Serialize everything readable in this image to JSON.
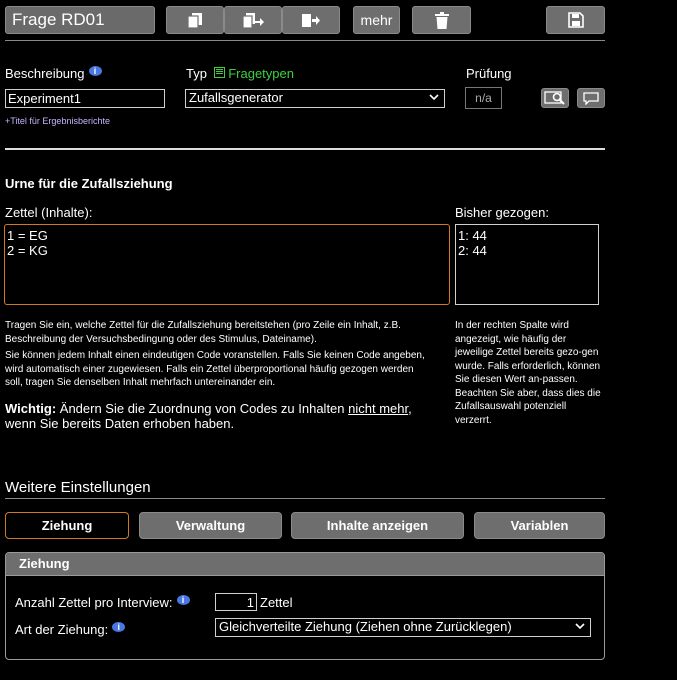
{
  "toolbar": {
    "question_id": "Frage RD01",
    "more_label": "mehr"
  },
  "header_fields": {
    "description_label": "Beschreibung",
    "description_value": "Experiment1",
    "type_label": "Typ",
    "question_types_link": "Fragetypen",
    "type_value": "Zufallsgenerator",
    "check_label": "Prüfung",
    "check_value": "n/a",
    "report_title_link": "+Titel für Ergebnisberichte"
  },
  "urn": {
    "heading": "Urne für die Zufallsziehung",
    "slips_label": "Zettel (Inhalte):",
    "slips_value": "1 = EG\n2 = KG",
    "drawn_label": "Bisher gezogen:",
    "drawn_value": "1: 44\n2: 44",
    "help_1": "Tragen Sie ein, welche Zettel für die Zufallsziehung bereitstehen (pro Zeile ein Inhalt, z.B. Beschreibung der Versuchsbedingung oder des Stimulus, Dateiname).",
    "help_2": "Sie können jedem Inhalt einen eindeutigen Code voranstellen. Falls Sie keinen Code angeben, wird automatisch einer zugewiesen. Falls ein Zettel überproportional häufig gezogen werden soll, tragen Sie denselben Inhalt mehrfach untereinander ein.",
    "warning_bold": "Wichtig:",
    "warning_text_1": " Ändern Sie die Zuordnung von Codes zu Inhalten ",
    "warning_underline": "nicht mehr",
    "warning_text_2": ",",
    "warning_text_3": "wenn Sie bereits Daten erhoben haben.",
    "right_help": "In der rechten Spalte wird angezeigt, wie häufig der jeweilige Zettel bereits gezo-gen wurde. Falls erforderlich, können Sie diesen Wert an-passen. Beachten Sie aber, dass dies die Zufallsauswahl potenziell verzerrt."
  },
  "settings": {
    "heading": "Weitere Einstellungen",
    "tabs": [
      "Ziehung",
      "Verwaltung",
      "Inhalte anzeigen",
      "Variablen"
    ],
    "panel_title": "Ziehung",
    "count_label": "Anzahl Zettel pro Interview:",
    "count_value": "1",
    "count_unit": "Zettel",
    "mode_label": "Art der Ziehung:",
    "mode_value": "Gleichverteilte Ziehung (Ziehen ohne Zurücklegen)"
  },
  "colors": {
    "button_bg": "#6e6e6e",
    "link_green": "#3ecf3e",
    "link_purple": "#c7b3ff",
    "active_border": "#d07a20",
    "info_blue": "#4a78e0"
  }
}
